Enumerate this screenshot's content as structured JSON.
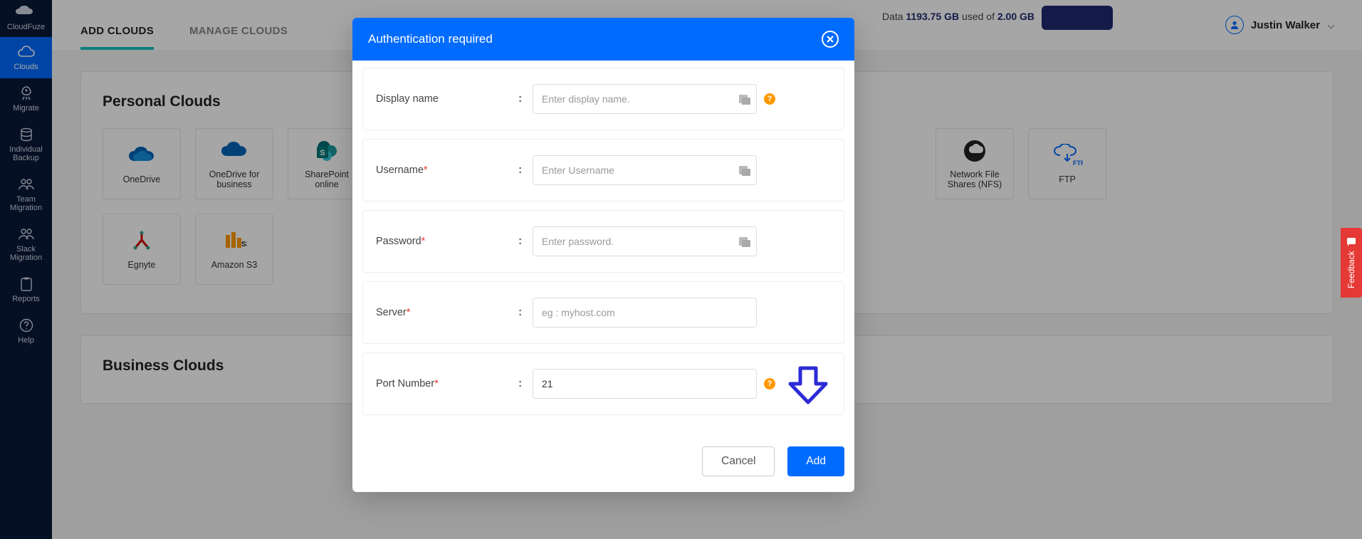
{
  "brand": "CloudFuze",
  "sidebar": {
    "items": [
      {
        "label": "CloudFuze"
      },
      {
        "label": "Clouds"
      },
      {
        "label": "Migrate"
      },
      {
        "label": "Individual Backup"
      },
      {
        "label": "Team Migration"
      },
      {
        "label": "Slack Migration"
      },
      {
        "label": "Reports"
      },
      {
        "label": "Help"
      }
    ]
  },
  "tabs": {
    "add_clouds": "ADD CLOUDS",
    "manage_clouds": "MANAGE CLOUDS"
  },
  "usage": {
    "prefix": "Data ",
    "used": "1193.75 GB",
    "middle": " used of ",
    "total": "2.00 GB"
  },
  "user": {
    "name": "Justin Walker"
  },
  "sections": {
    "personal_title": "Personal Clouds",
    "business_title": "Business Clouds"
  },
  "clouds": {
    "onedrive": "OneDrive",
    "onedrive_biz": "OneDrive for business",
    "sharepoint": "SharePoint online",
    "nfs": "Network File Shares (NFS)",
    "ftp": "FTP",
    "egnyte": "Egnyte",
    "s3": "Amazon S3"
  },
  "modal": {
    "title": "Authentication required",
    "display_name_label": "Display name",
    "display_name_ph": "Enter display name.",
    "username_label": "Username",
    "username_ph": "Enter Username",
    "password_label": "Password",
    "password_ph": "Enter password.",
    "server_label": "Server",
    "server_ph": "eg : myhost.com",
    "port_label": "Port Number",
    "port_value": "21",
    "cancel": "Cancel",
    "add": "Add",
    "help_char": "?"
  },
  "feedback_label": "Feedback"
}
